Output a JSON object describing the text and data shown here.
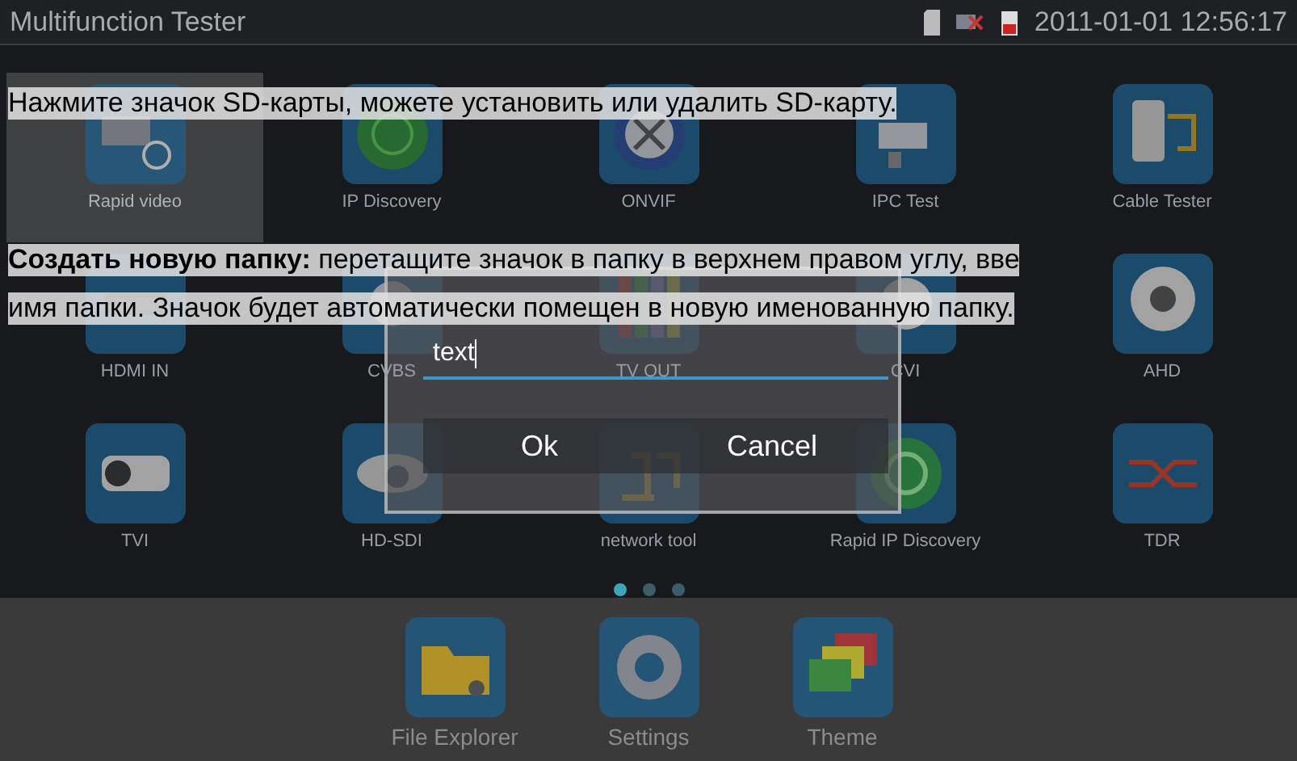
{
  "status_bar": {
    "title": "Multifunction Tester",
    "datetime": "2011-01-01 12:56:17"
  },
  "apps": [
    {
      "label": "Rapid video",
      "selected": true
    },
    {
      "label": "IP Discovery",
      "selected": false
    },
    {
      "label": "ONVIF",
      "selected": false
    },
    {
      "label": "IPC Test",
      "selected": false
    },
    {
      "label": "Cable Tester",
      "selected": false
    },
    {
      "label": "HDMI IN",
      "selected": false
    },
    {
      "label": "CVBS",
      "selected": false
    },
    {
      "label": "TV OUT",
      "selected": false
    },
    {
      "label": "CVI",
      "selected": false
    },
    {
      "label": "AHD",
      "selected": false
    },
    {
      "label": "TVI",
      "selected": false
    },
    {
      "label": "HD-SDI",
      "selected": false
    },
    {
      "label": "network tool",
      "selected": false
    },
    {
      "label": "Rapid IP Discovery",
      "selected": false
    },
    {
      "label": "TDR",
      "selected": false
    }
  ],
  "page_dots": [
    {
      "selected": true
    },
    {
      "selected": false
    },
    {
      "selected": false
    }
  ],
  "dock": [
    {
      "label": "File Explorer"
    },
    {
      "label": "Settings"
    },
    {
      "label": "Theme"
    }
  ],
  "dialog": {
    "value": "text",
    "buttons": [
      "Ok",
      "Cancel"
    ]
  },
  "annotations": [
    "Нажмите значок SD-карты, можете установить или удалить SD-карту.",
    "**Создать новую папку:** перетащите значок в папку в верхнем правом углу, вве",
    "имя папки. Значок будет автоматически помещен в новую именованную папку."
  ]
}
